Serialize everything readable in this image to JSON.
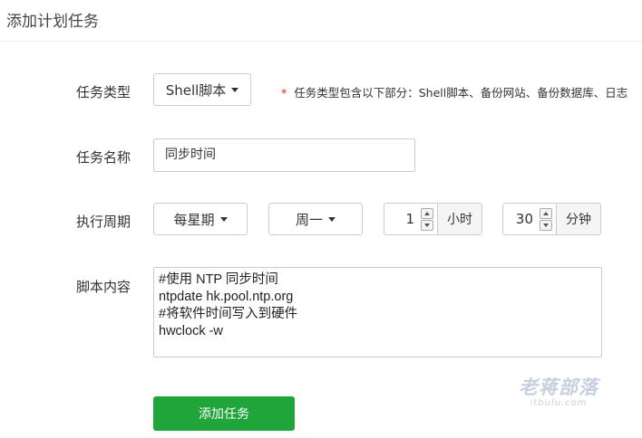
{
  "header": {
    "title": "添加计划任务"
  },
  "form": {
    "task_type": {
      "label": "任务类型",
      "value": "Shell脚本",
      "note_star": "*",
      "note": "任务类型包含以下部分：Shell脚本、备份网站、备份数据库、日志"
    },
    "task_name": {
      "label": "任务名称",
      "value": "同步时间"
    },
    "schedule": {
      "label": "执行周期",
      "period": "每星期",
      "weekday": "周一",
      "hour_value": "1",
      "hour_unit": "小时",
      "minute_value": "30",
      "minute_unit": "分钟"
    },
    "script": {
      "label": "脚本内容",
      "content": "#使用 NTP 同步时间\nntpdate hk.pool.ntp.org\n#将软件时间写入到硬件\nhwclock -w"
    },
    "submit_label": "添加任务"
  },
  "watermark": {
    "main": "老蒋部落",
    "sub": "itbulu.com"
  },
  "colors": {
    "primary": "#20a53a",
    "required_star": "#e02020"
  }
}
